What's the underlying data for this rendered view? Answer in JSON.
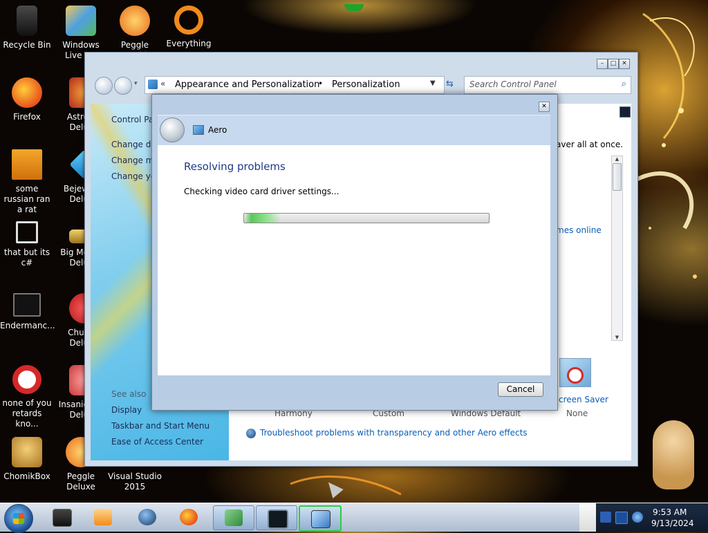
{
  "desktop": {
    "icons": [
      {
        "label": "Recycle Bin",
        "icon": "recycle-bin-icon",
        "color": "#2b2b2b"
      },
      {
        "label": "Windows Live Ma",
        "icon": "windows-live-icon",
        "color": "#e8a73c"
      },
      {
        "label": "Peggle World",
        "icon": "peggle-icon",
        "color": "#f0962a"
      },
      {
        "label": "Everything",
        "icon": "everything-icon",
        "color": "#f08a1c"
      },
      {
        "label": "Firefox",
        "icon": "firefox-icon",
        "color": "#e8541c"
      },
      {
        "label": "Astro Delu",
        "icon": "astro-icon",
        "color": "#d93a2a"
      },
      {
        "label": "some russian ran a rat",
        "icon": "file-icon",
        "color": "#e07a10"
      },
      {
        "label": "Bejew Delu",
        "icon": "bejeweled-icon",
        "color": "#2aa6d8"
      },
      {
        "label": "that but its c#",
        "icon": "shortcut-icon",
        "color": "#dddddd"
      },
      {
        "label": "Big Mo Delu",
        "icon": "bigmoney-icon",
        "color": "#c8a040"
      },
      {
        "label": "Endermanc...",
        "icon": "monitor-icon",
        "color": "#1a1a1a"
      },
      {
        "label": "Chuz Delu",
        "icon": "chuzzle-icon",
        "color": "#d33a3a"
      },
      {
        "label": "none of you retards kno...",
        "icon": "opera-icon",
        "color": "#d62828"
      },
      {
        "label": "Insaniq Delu",
        "icon": "insaniquarium-icon",
        "color": "#c83a3a"
      },
      {
        "label": "ChomikBox",
        "icon": "hamster-icon",
        "color": "#e0a030"
      },
      {
        "label": "Peggle Deluxe",
        "icon": "peggle-icon",
        "color": "#f0962a"
      },
      {
        "label": "Visual Studio 2015",
        "icon": "visual-studio-icon",
        "color": "#68217a"
      }
    ]
  },
  "control_panel": {
    "breadcrumb": [
      "Appearance and Personalization",
      "Personalization"
    ],
    "search_placeholder": "Search Control Panel",
    "sidebar": {
      "home_link": "Control Par",
      "links": [
        "Change des",
        "Change mo",
        "Change you"
      ],
      "see_also_label": "See also",
      "see_also_links": [
        "Display",
        "Taskbar and Start Menu",
        "Ease of Access Center"
      ]
    },
    "content": {
      "intro_fragment": "aver all at once.",
      "link_fragment": "mes online",
      "screen_saver_label": "creen Saver",
      "screen_saver_value": "None",
      "theme_captions": [
        "Harmony",
        "Custom",
        "Windows Default"
      ],
      "troubleshoot_link": "Troubleshoot problems with transparency and other Aero effects"
    }
  },
  "dialog": {
    "title": "Aero",
    "heading": "Resolving problems",
    "status": "Checking video card driver settings...",
    "progress": 0.15,
    "cancel_label": "Cancel"
  },
  "taskbar": {
    "items": [
      {
        "icon": "cmd-window-icon",
        "active": false
      },
      {
        "icon": "media-player-icon",
        "active": false
      },
      {
        "icon": "globe-icon",
        "active": false
      },
      {
        "icon": "firefox-icon",
        "active": false
      },
      {
        "icon": "control-panel-icon",
        "active": true
      },
      {
        "icon": "monitor-icon",
        "active": true
      },
      {
        "icon": "personalization-icon",
        "active": true
      }
    ],
    "clock_time": "9:53 AM",
    "clock_date": "9/13/2024"
  }
}
